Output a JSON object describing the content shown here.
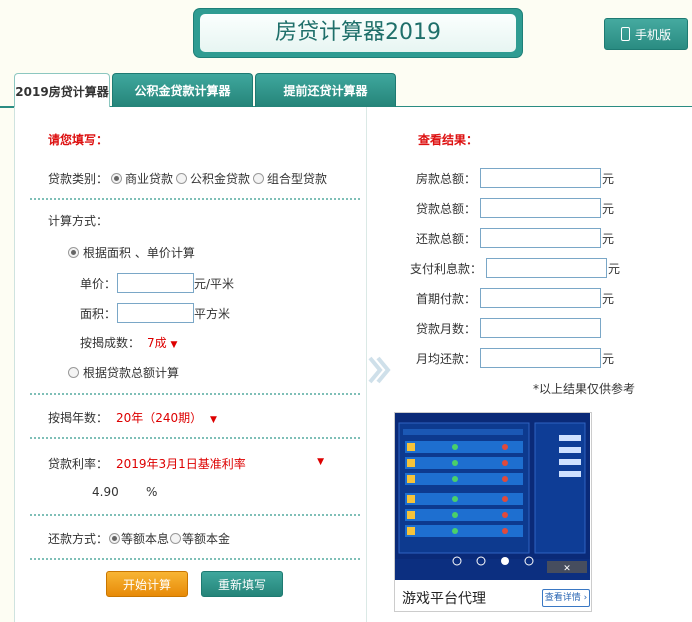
{
  "header": {
    "title": "房贷计算器2019",
    "mobile_label": "手机版"
  },
  "tabs": [
    {
      "label": "2019房贷计算器"
    },
    {
      "label": "公积金贷款计算器"
    },
    {
      "label": "提前还贷计算器"
    }
  ],
  "form": {
    "section_title": "请您填写：",
    "loan_type_label": "贷款类别：",
    "loan_types": [
      "商业贷款",
      "公积金贷款",
      "组合型贷款"
    ],
    "calc_method_label": "计算方式：",
    "method_area": "根据面积 、单价计算",
    "unit_price_label": "单价：",
    "unit_price_unit": "元/平米",
    "area_label": "面积：",
    "area_unit": "平方米",
    "mortgage_ratio_label": "按揭成数：",
    "mortgage_ratio_value": "7成",
    "method_total": "根据贷款总额计算",
    "years_label": "按揭年数：",
    "years_value": "20年（240期）",
    "rate_label": "贷款利率：",
    "rate_value": "2019年3月1日基准利率",
    "rate_number": "4.90",
    "rate_percent": "%",
    "repay_label": "还款方式：",
    "repay_options": [
      "等额本息",
      "等额本金"
    ],
    "start_button": "开始计算",
    "reset_button": "重新填写"
  },
  "results": {
    "section_title": "查看结果：",
    "rows": [
      {
        "label": "房款总额：",
        "unit": "元"
      },
      {
        "label": "贷款总额：",
        "unit": "元"
      },
      {
        "label": "还款总额：",
        "unit": "元"
      },
      {
        "label": "支付利息款：",
        "unit": "元"
      },
      {
        "label": "首期付款：",
        "unit": "元"
      },
      {
        "label": "贷款月数：",
        "unit": ""
      },
      {
        "label": "月均还款：",
        "unit": "元"
      }
    ],
    "note": "*以上结果仅供参考"
  },
  "ad": {
    "caption": "游戏平台代理",
    "detail_button": "查看详情 ›",
    "carousel_active_index": 2
  }
}
